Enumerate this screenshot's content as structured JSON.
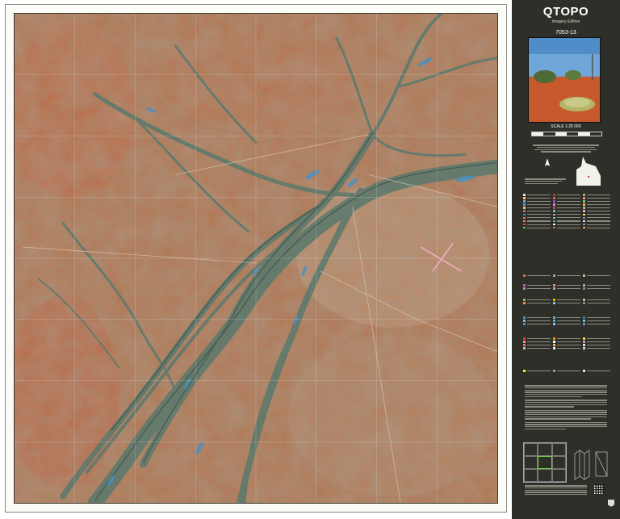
{
  "panel": {
    "brand": "QTOPO",
    "brand_subtitle": "Imagery Edition",
    "sheet_number": "7053-13",
    "scale_label": "SCALE 1:25 000"
  },
  "map": {
    "imagery_description": "satellite imagery with braided river channels",
    "colors": {
      "terrain": "#b5714a",
      "channels": "#5f7a6d",
      "water": "#4a8fc4",
      "panel": "#2f2f29",
      "frame": "#fbfbf7"
    }
  },
  "icons": [
    "queensland-outline-icon",
    "north-arrow-icon",
    "qr-code-icon",
    "crest-icon"
  ]
}
